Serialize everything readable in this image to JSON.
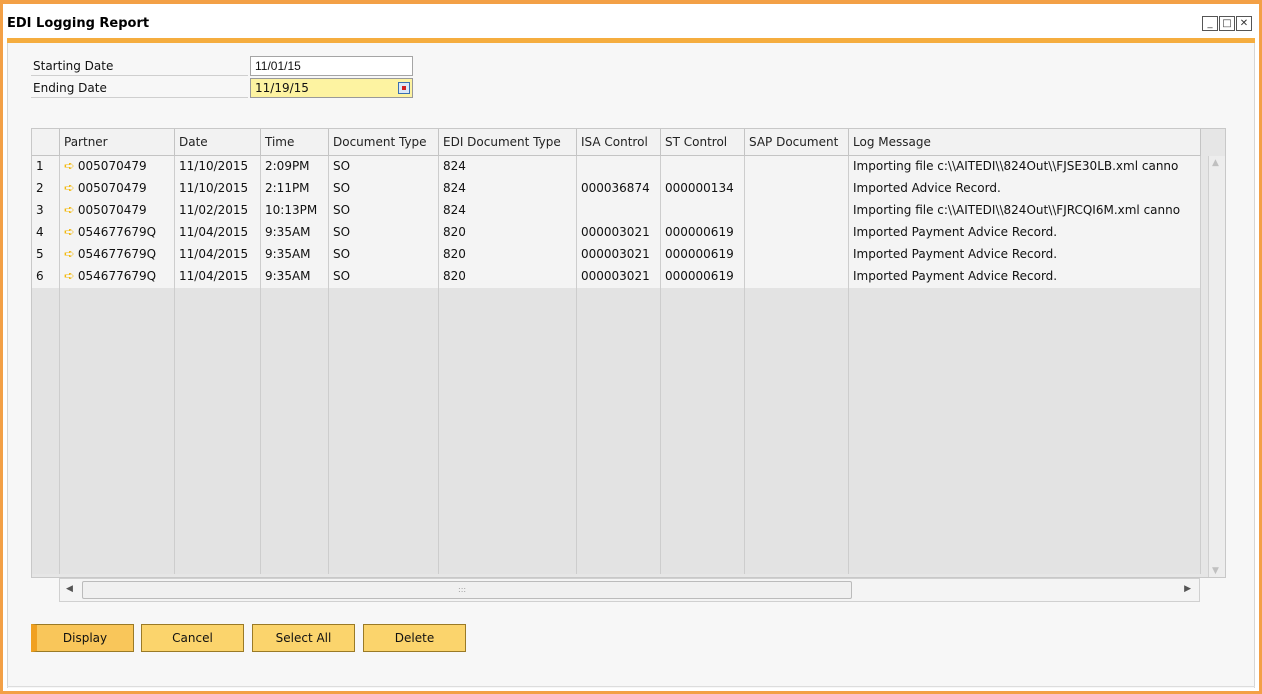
{
  "window": {
    "title": "EDI Logging Report",
    "controls": [
      "minimize",
      "maximize",
      "close"
    ]
  },
  "form": {
    "starting_date_label": "Starting Date",
    "starting_date_value": "11/01/15",
    "ending_date_label": "Ending Date",
    "ending_date_value": "11/19/15"
  },
  "grid": {
    "columns": [
      "",
      "Partner",
      "Date",
      "Time",
      "Document Type",
      "EDI Document Type",
      "ISA Control",
      "ST Control",
      "SAP Document",
      "Log Message"
    ],
    "rows": [
      {
        "num": "1",
        "partner": "005070479",
        "date": "11/10/2015",
        "time": "2:09PM",
        "doc_type": "SO",
        "edi_type": "824",
        "isa": "",
        "st": "",
        "sap": "",
        "log": "Importing file c:\\\\AITEDI\\\\824Out\\\\FJSE30LB.xml canno"
      },
      {
        "num": "2",
        "partner": "005070479",
        "date": "11/10/2015",
        "time": "2:11PM",
        "doc_type": "SO",
        "edi_type": "824",
        "isa": "000036874",
        "st": "000000134",
        "sap": "",
        "log": "Imported Advice Record."
      },
      {
        "num": "3",
        "partner": "005070479",
        "date": "11/02/2015",
        "time": "10:13PM",
        "doc_type": "SO",
        "edi_type": "824",
        "isa": "",
        "st": "",
        "sap": "",
        "log": "Importing file c:\\\\AITEDI\\\\824Out\\\\FJRCQI6M.xml canno"
      },
      {
        "num": "4",
        "partner": "054677679Q",
        "date": "11/04/2015",
        "time": "9:35AM",
        "doc_type": "SO",
        "edi_type": "820",
        "isa": "000003021",
        "st": "000000619",
        "sap": "",
        "log": "Imported Payment Advice Record."
      },
      {
        "num": "5",
        "partner": "054677679Q",
        "date": "11/04/2015",
        "time": "9:35AM",
        "doc_type": "SO",
        "edi_type": "820",
        "isa": "000003021",
        "st": "000000619",
        "sap": "",
        "log": "Imported Payment Advice Record."
      },
      {
        "num": "6",
        "partner": "054677679Q",
        "date": "11/04/2015",
        "time": "9:35AM",
        "doc_type": "SO",
        "edi_type": "820",
        "isa": "000003021",
        "st": "000000619",
        "sap": "",
        "log": "Imported Payment Advice Record."
      }
    ],
    "row_icon": "link-arrow-icon"
  },
  "buttons": {
    "display": "Display",
    "cancel": "Cancel",
    "select_all": "Select All",
    "delete": "Delete"
  },
  "colors": {
    "window_border": "#f3a046",
    "button_fill": "#fbd46c",
    "active_field": "#fdf3a1",
    "row_arrow": "#f2b80c"
  }
}
